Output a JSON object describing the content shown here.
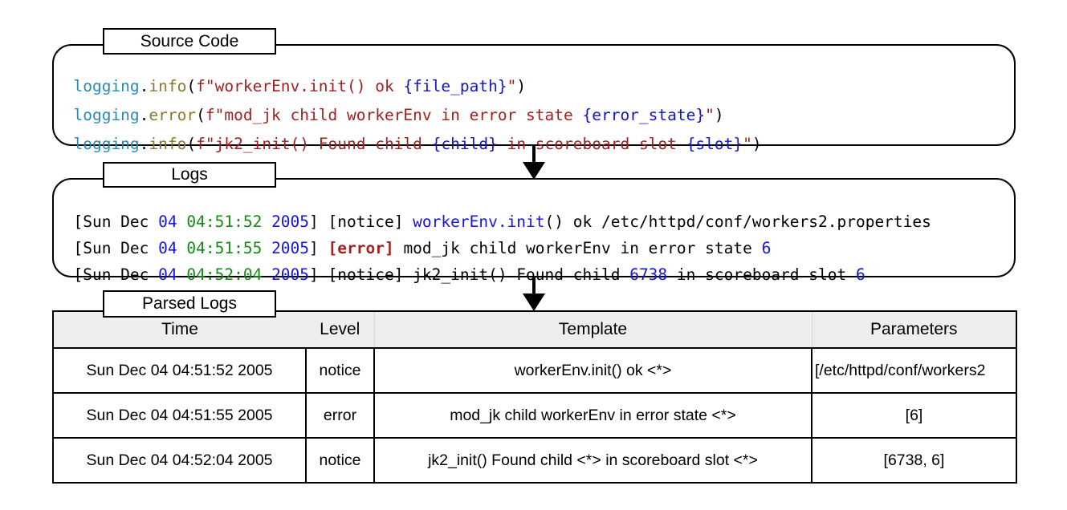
{
  "source": {
    "tab_label": "Source Code",
    "lines": [
      {
        "obj": "logging",
        "dot": ".",
        "fn": "info",
        "open": "(",
        "prefix": "f\"",
        "parts": [
          {
            "t": "workerEnv.init() ok ",
            "k": "str"
          },
          {
            "t": "{file_path}",
            "k": "var"
          },
          {
            "t": "\"",
            "k": "str"
          }
        ],
        "close": ")"
      },
      {
        "obj": "logging",
        "dot": ".",
        "fn": "error",
        "open": "(",
        "prefix": "f\"",
        "parts": [
          {
            "t": "mod_jk child workerEnv in error state ",
            "k": "str"
          },
          {
            "t": "{error_state}",
            "k": "var"
          },
          {
            "t": "\"",
            "k": "str"
          }
        ],
        "close": ")"
      },
      {
        "obj": "logging",
        "dot": ".",
        "fn": "info",
        "open": "(",
        "prefix": "f\"",
        "parts": [
          {
            "t": "jk2_init() Found child ",
            "k": "str"
          },
          {
            "t": "{child}",
            "k": "var"
          },
          {
            "t": " in scoreboard slot ",
            "k": "str"
          },
          {
            "t": "{slot}",
            "k": "var"
          },
          {
            "t": "\"",
            "k": "str"
          }
        ],
        "close": ")"
      }
    ]
  },
  "logs": {
    "tab_label": "Logs",
    "lines": [
      [
        {
          "t": "[Sun Dec ",
          "k": "plain"
        },
        {
          "t": "04",
          "k": "blue"
        },
        {
          "t": " ",
          "k": "plain"
        },
        {
          "t": "04:51:52",
          "k": "green"
        },
        {
          "t": " ",
          "k": "plain"
        },
        {
          "t": "2005",
          "k": "blue"
        },
        {
          "t": "] [notice] ",
          "k": "plain"
        },
        {
          "t": "workerEnv.init",
          "k": "blue"
        },
        {
          "t": "() ok /etc/httpd/conf/workers2.properties",
          "k": "plain"
        }
      ],
      [
        {
          "t": "[Sun Dec ",
          "k": "plain"
        },
        {
          "t": "04",
          "k": "blue"
        },
        {
          "t": " ",
          "k": "plain"
        },
        {
          "t": "04:51:55",
          "k": "green"
        },
        {
          "t": " ",
          "k": "plain"
        },
        {
          "t": "2005",
          "k": "blue"
        },
        {
          "t": "] ",
          "k": "plain"
        },
        {
          "t": "[error]",
          "k": "err"
        },
        {
          "t": " mod_jk child workerEnv in error state ",
          "k": "plain"
        },
        {
          "t": "6",
          "k": "blue"
        }
      ],
      [
        {
          "t": "[Sun Dec ",
          "k": "plain"
        },
        {
          "t": "04",
          "k": "blue"
        },
        {
          "t": " ",
          "k": "plain"
        },
        {
          "t": "04:52:04",
          "k": "green"
        },
        {
          "t": " ",
          "k": "plain"
        },
        {
          "t": "2005",
          "k": "blue"
        },
        {
          "t": "] [notice] jk2_init() Found child ",
          "k": "plain"
        },
        {
          "t": "6738",
          "k": "blue"
        },
        {
          "t": " in scoreboard slot ",
          "k": "plain"
        },
        {
          "t": "6",
          "k": "blue"
        }
      ]
    ]
  },
  "parsed": {
    "tab_label": "Parsed Logs",
    "headers": {
      "time": "Time",
      "level": "Level",
      "template": "Template",
      "parameters": "Parameters"
    },
    "rows": [
      {
        "time": "Sun Dec 04 04:51:52 2005",
        "level": "notice",
        "template": "workerEnv.init() ok <*>",
        "parameters": "[/etc/httpd/conf/workers2"
      },
      {
        "time": "Sun Dec 04 04:51:55 2005",
        "level": "error",
        "template": "mod_jk child workerEnv in error state <*>",
        "parameters": "[6]"
      },
      {
        "time": "Sun Dec 04 04:52:04 2005",
        "level": "notice",
        "template": "jk2_init() Found child <*> in scoreboard slot <*>",
        "parameters": "[6738, 6]"
      }
    ]
  }
}
